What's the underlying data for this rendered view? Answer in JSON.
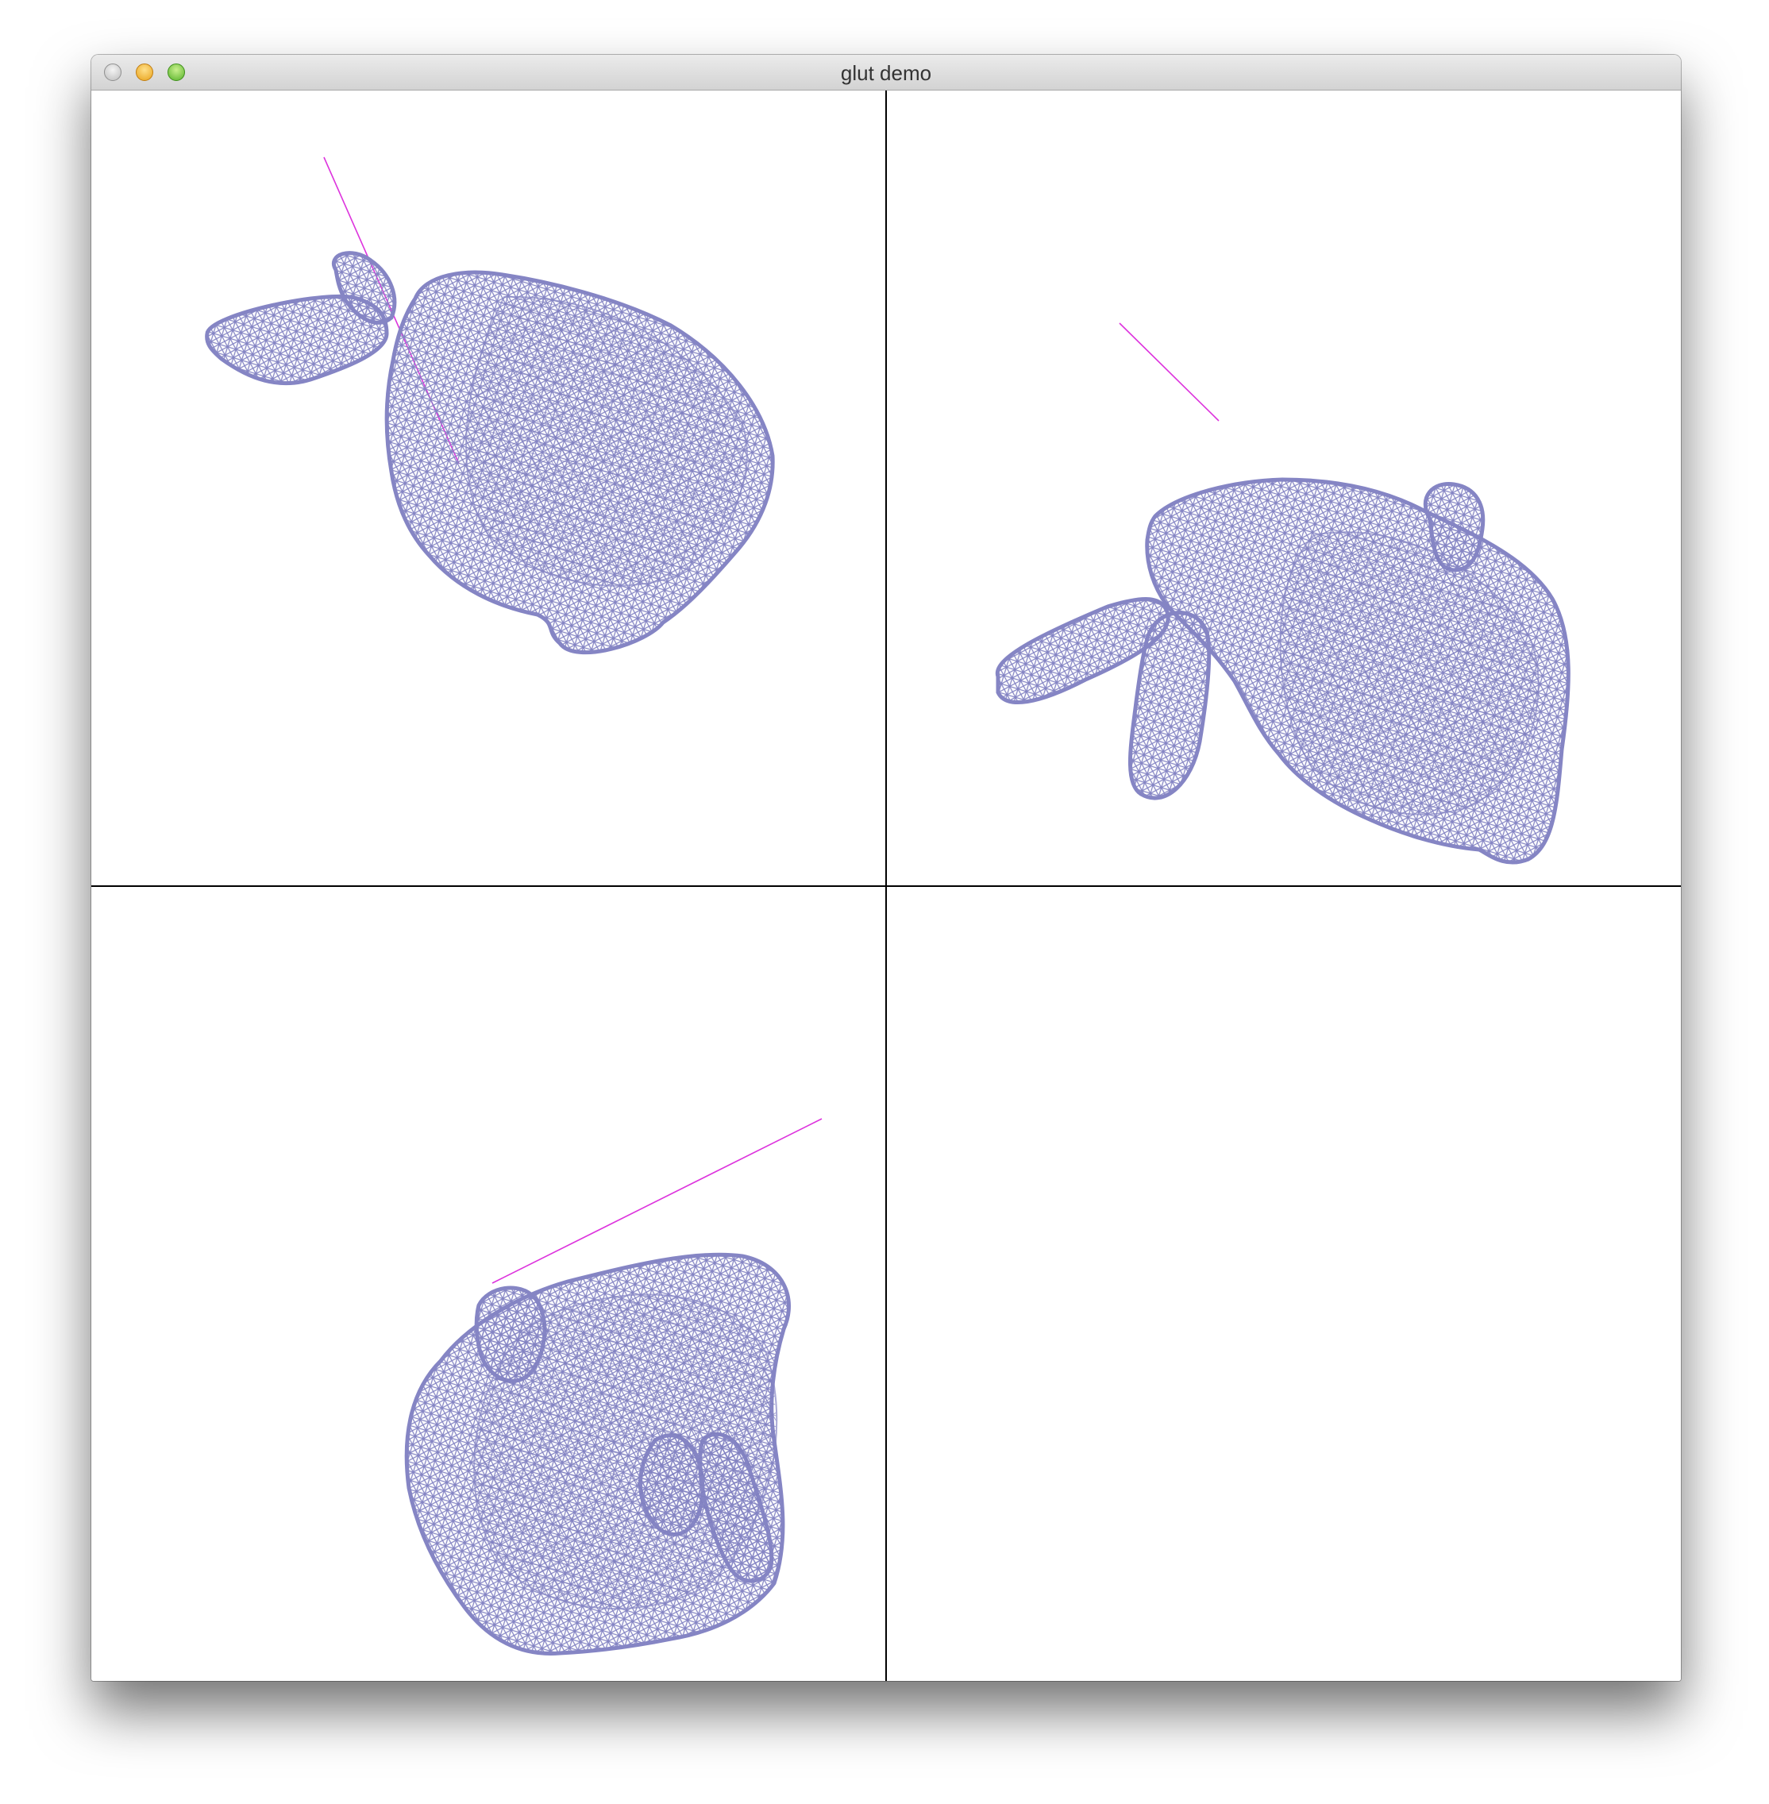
{
  "window": {
    "title": "glut demo",
    "controls": [
      "close",
      "minimize",
      "zoom"
    ]
  },
  "viewports": [
    {
      "id": "top-left",
      "content": "wireframe-bunny"
    },
    {
      "id": "top-right",
      "content": "wireframe-bunny"
    },
    {
      "id": "bottom-left",
      "content": "wireframe-bunny"
    },
    {
      "id": "bottom-right",
      "content": "empty"
    }
  ],
  "colors": {
    "mesh": "#8585c4",
    "ray": "#dd33dd",
    "divider": "#000000",
    "background": "#ffffff"
  }
}
